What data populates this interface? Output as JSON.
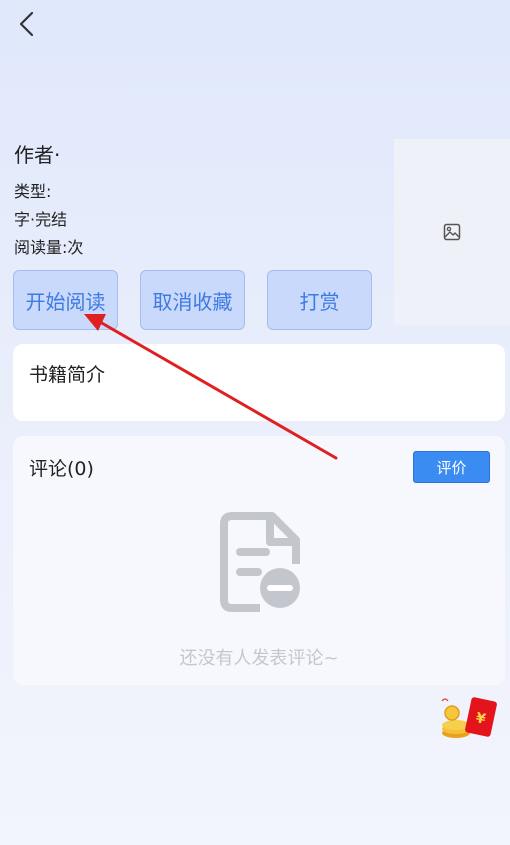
{
  "header": {
    "back_icon": "chevron-left-icon"
  },
  "book": {
    "author_label": "作者·",
    "type_label": "类型:",
    "words_label": "字·完结",
    "reads_label": "阅读量:次",
    "cover_icon": "image-placeholder-icon"
  },
  "actions": {
    "start_read": "开始阅读",
    "unfavorite": "取消收藏",
    "tip": "打赏"
  },
  "intro": {
    "title": "书籍简介"
  },
  "comments": {
    "title": "评论(0)",
    "rate_label": "评价",
    "empty_text": "还没有人发表评论~",
    "empty_icon": "document-empty-icon"
  },
  "floating": {
    "red_packet_icon": "red-packet-icon",
    "red_packet_symbol": "¥"
  },
  "colors": {
    "accent": "#3a8cf3",
    "button_bg": "#c8d9fb",
    "button_text": "#3e7ae3",
    "annotation_arrow": "#e02020"
  }
}
